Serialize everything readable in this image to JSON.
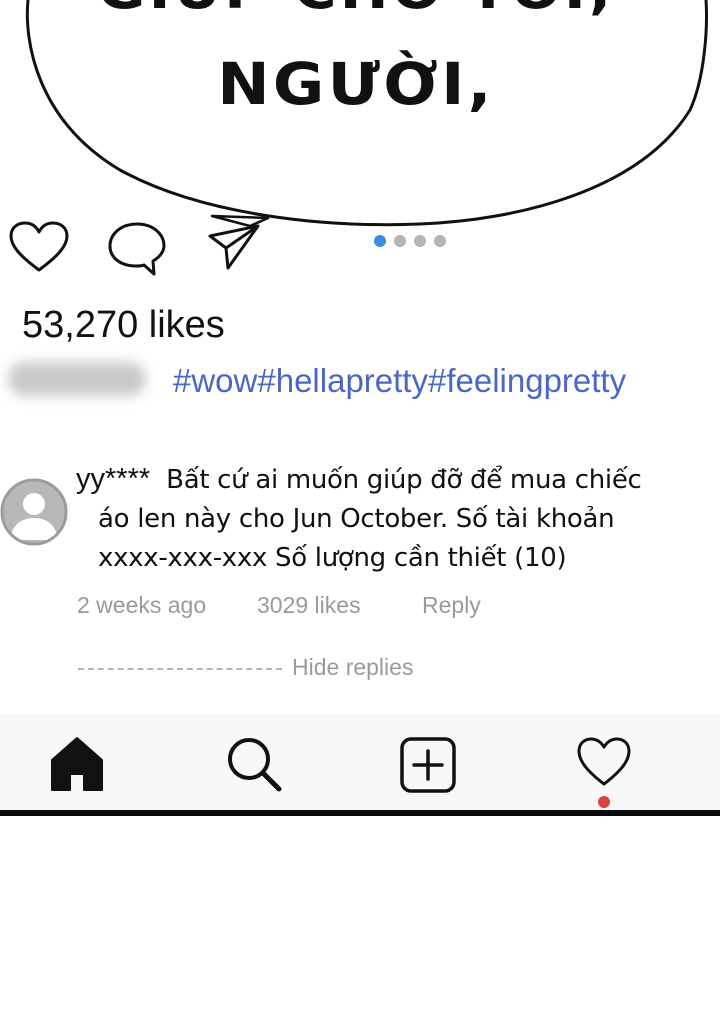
{
  "bubble": {
    "line1": "GIÚP CHO TÔI,",
    "line2": "NGƯỜI,"
  },
  "post": {
    "likes": "53,270 likes",
    "hashtags": "#wow#hellapretty#feelingpretty",
    "carousel_pages": 4,
    "carousel_active_index": 0
  },
  "comment": {
    "user": "yy****",
    "lines": [
      "Bất cứ ai muốn giúp đỡ để mua chiếc",
      "áo len này cho Jun October. Số tài khoản",
      "xxxx-xxx-xxx Số lượng cần thiết (10)"
    ],
    "time": "2 weeks ago",
    "likes": "3029 likes",
    "reply": "Reply",
    "hide_replies": "Hide replies"
  },
  "icons": {
    "actions": [
      "heart-icon",
      "comment-icon",
      "send-icon"
    ],
    "nav": [
      "home-icon",
      "search-icon",
      "add-post-icon",
      "activity-heart-icon"
    ]
  },
  "colors": {
    "hashtag": "#4a67c7",
    "dot_active": "#3a8de0",
    "dot_inactive": "#b5b5b5",
    "meta_text": "#9a9a9a",
    "notification": "#d64545",
    "nav_bg": "#f8f8f8"
  }
}
